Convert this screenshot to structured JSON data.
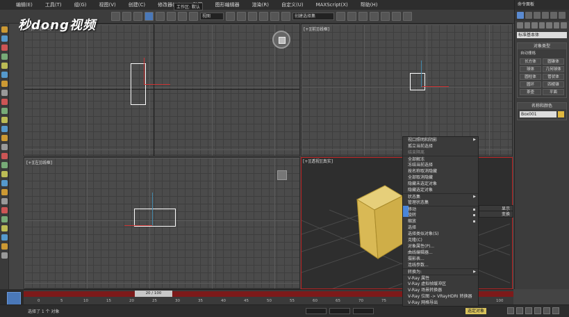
{
  "watermark": "秒dong视频",
  "menubar": {
    "items": [
      "编辑(E)",
      "工具(T)",
      "组(G)",
      "视图(V)",
      "创建(C)",
      "修改器(M)",
      "动画",
      "图形编辑器",
      "渲染(R)",
      "自定义(U)",
      "MAXScript(X)",
      "帮助(H)"
    ],
    "workspace_dropdown": "工作区: 默认"
  },
  "toolbar": {
    "view_dropdown": "视图",
    "selection_dropdown": "创建选择集"
  },
  "viewports": {
    "top": {
      "label": "[+][顶][线框]"
    },
    "front": {
      "label": "[+][前][线框]"
    },
    "left": {
      "label": "[+][左][线框]"
    },
    "perspective": {
      "label": "[+][透视][真实]"
    }
  },
  "command_panel": {
    "title": "命令面板",
    "category_dropdown": "标准基本体",
    "object_type": {
      "header": "对象类型",
      "autogrid": "自动栅格",
      "buttons": [
        "长方体",
        "圆锥体",
        "球体",
        "几何球体",
        "圆柱体",
        "管状体",
        "圆环",
        "四棱锥",
        "茶壶",
        "平面"
      ]
    },
    "name_color": {
      "header": "名称和颜色",
      "name_value": "Box001"
    },
    "swatch_color": "#e0b840"
  },
  "context_menu": {
    "items": [
      {
        "label": "视口照明和阴影",
        "state": "normal",
        "submenu": true
      },
      {
        "label": "孤立当前选择",
        "state": "normal"
      },
      {
        "label": "结束隔离",
        "state": "disabled"
      },
      {
        "label": "全部解冻",
        "state": "normal",
        "sep": true
      },
      {
        "label": "冻结当前选择",
        "state": "normal"
      },
      {
        "label": "按名称取消隐藏",
        "state": "normal"
      },
      {
        "label": "全部取消隐藏",
        "state": "normal"
      },
      {
        "label": "隐藏未选定对象",
        "state": "normal"
      },
      {
        "label": "隐藏选定对象",
        "state": "normal"
      },
      {
        "label": "状态集",
        "state": "normal",
        "submenu": true,
        "sep": true
      },
      {
        "label": "管理状态集",
        "state": "normal"
      },
      {
        "label": "移动",
        "state": "normal",
        "sep": true,
        "box": true
      },
      {
        "label": "旋转",
        "state": "normal",
        "box": true
      },
      {
        "label": "缩放",
        "state": "normal",
        "box": true
      },
      {
        "label": "选择",
        "state": "normal"
      },
      {
        "label": "选择类似对象(S)",
        "state": "normal"
      },
      {
        "label": "克隆(C)",
        "state": "normal"
      },
      {
        "label": "对象属性(P)...",
        "state": "normal"
      },
      {
        "label": "曲线编辑器...",
        "state": "normal"
      },
      {
        "label": "摄影表...",
        "state": "normal"
      },
      {
        "label": "连线参数...",
        "state": "normal"
      },
      {
        "label": "转换为:",
        "state": "normal",
        "submenu": true,
        "sep": true
      },
      {
        "label": "V-Ray 属性",
        "state": "normal",
        "sep": true
      },
      {
        "label": "V-Ray 虚拟帧缓冲区",
        "state": "normal"
      },
      {
        "label": "V-Ray 场景转换器",
        "state": "normal"
      },
      {
        "label": "V-Ray 位图 -> VRayHDRI 转换器",
        "state": "normal"
      },
      {
        "label": "V-Ray 网格导出",
        "state": "normal"
      }
    ],
    "quad_right": [
      "显示",
      "变换"
    ]
  },
  "timeline": {
    "frame_counter": "20 / 100",
    "ticks": [
      "0",
      "5",
      "10",
      "15",
      "20",
      "25",
      "30",
      "35",
      "40",
      "45",
      "50",
      "55",
      "60",
      "65",
      "70",
      "75",
      "80",
      "85",
      "90",
      "95",
      "100"
    ]
  },
  "status": {
    "selection_text": "选择了 1 个 对象",
    "selected_set": "选定对象"
  }
}
